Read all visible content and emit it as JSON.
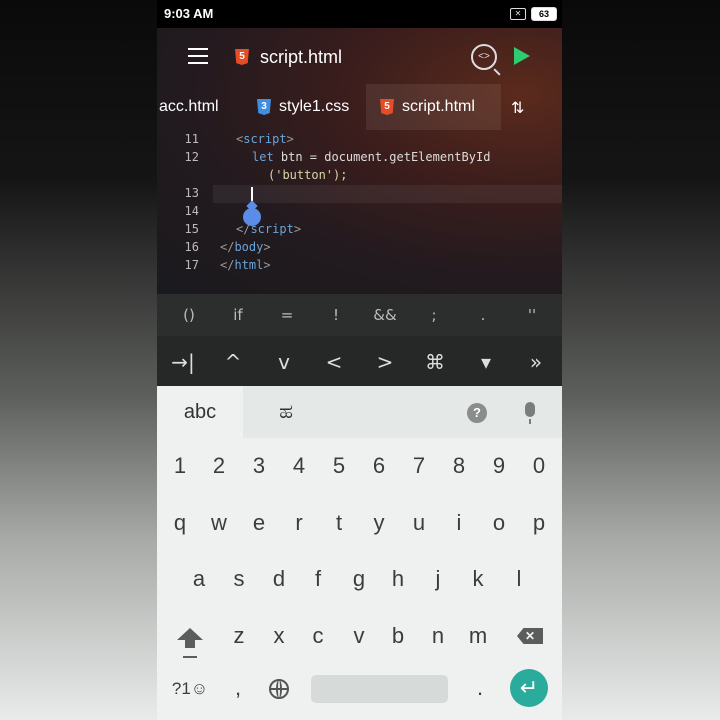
{
  "status_bar": {
    "time": "9:03 AM",
    "battery": "63",
    "sim_icon": "sim-x-icon"
  },
  "app_bar": {
    "title": "script.html",
    "menu_icon": "hamburger-icon",
    "preview_icon": "preview-icon",
    "run_icon": "play-icon"
  },
  "tabs": [
    {
      "label": "acc.html",
      "icon": "html5-icon"
    },
    {
      "label": "style1.css",
      "icon": "css3-icon"
    },
    {
      "label": "script.html",
      "icon": "html5-icon",
      "active": true
    }
  ],
  "sort_icon": "⇅",
  "code": {
    "lines": [
      {
        "num": "11",
        "open": "<",
        "tag": "script",
        "close": ">"
      },
      {
        "num": "12",
        "text_kw": "let",
        "text_rest": " btn = document.getElementById"
      },
      {
        "num": "",
        "text_str": "('button');"
      },
      {
        "num": "13"
      },
      {
        "num": "14"
      },
      {
        "num": "15",
        "open": "</",
        "tag": "script",
        "close": ">"
      },
      {
        "num": "16",
        "open": "</",
        "tag": "body",
        "close": ">"
      },
      {
        "num": "17",
        "open": "</",
        "tag": "html",
        "close": ">"
      }
    ]
  },
  "symbols": [
    "()",
    "if",
    "=",
    "!",
    "&&",
    ";",
    ".",
    "''"
  ],
  "nav_keys": [
    "→|",
    "^",
    "v",
    "<",
    ">",
    "⌘",
    "▾",
    "»"
  ],
  "keyboard": {
    "tab_abc": "abc",
    "tab_script": "ಹ",
    "help": "?",
    "row_numbers": [
      "1",
      "2",
      "3",
      "4",
      "5",
      "6",
      "7",
      "8",
      "9",
      "0"
    ],
    "row1": [
      "q",
      "w",
      "e",
      "r",
      "t",
      "y",
      "u",
      "i",
      "o",
      "p"
    ],
    "row2": [
      "a",
      "s",
      "d",
      "f",
      "g",
      "h",
      "j",
      "k",
      "l"
    ],
    "row3": [
      "z",
      "x",
      "c",
      "v",
      "b",
      "n",
      "m"
    ],
    "symbols_key": "?1☺",
    "comma": ",",
    "period": ".",
    "enter": "↵",
    "backspace": "✕"
  }
}
